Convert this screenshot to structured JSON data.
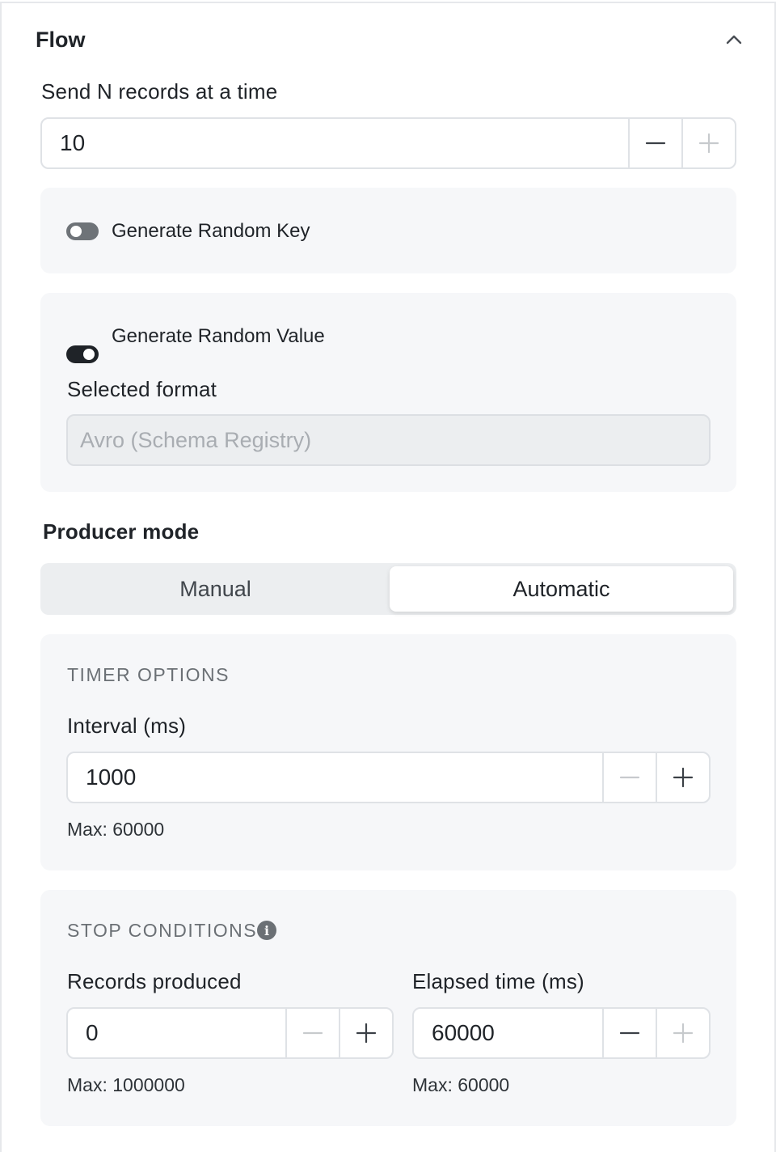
{
  "section": {
    "title": "Flow",
    "collapse_icon": "chevron-up-icon"
  },
  "records_per_batch": {
    "label": "Send N records at a time",
    "value": "10"
  },
  "random_key": {
    "label": "Generate Random Key",
    "enabled": false
  },
  "random_value": {
    "label": "Generate Random Value",
    "enabled": true,
    "format_label": "Selected format",
    "format_placeholder": "Avro (Schema Registry)"
  },
  "producer_mode": {
    "label": "Producer mode",
    "options": [
      "Manual",
      "Automatic"
    ],
    "selected": "Automatic"
  },
  "timer_options": {
    "caption": "TIMER OPTIONS",
    "interval_label": "Interval (ms)",
    "interval_value": "1000",
    "interval_hint": "Max: 60000"
  },
  "stop_conditions": {
    "caption": "STOP CONDITIONS",
    "info_icon": "info-icon",
    "records_label": "Records produced",
    "records_value": "0",
    "records_hint": "Max: 1000000",
    "elapsed_label": "Elapsed time (ms)",
    "elapsed_value": "60000",
    "elapsed_hint": "Max: 60000"
  },
  "colors": {
    "border": "#dfe2e6",
    "card_bg": "#f6f7f9",
    "toggle_on": "#1f2328",
    "toggle_off": "#6e7378",
    "disabled_icon": "#c7cacd",
    "active_icon": "#3b4046"
  }
}
